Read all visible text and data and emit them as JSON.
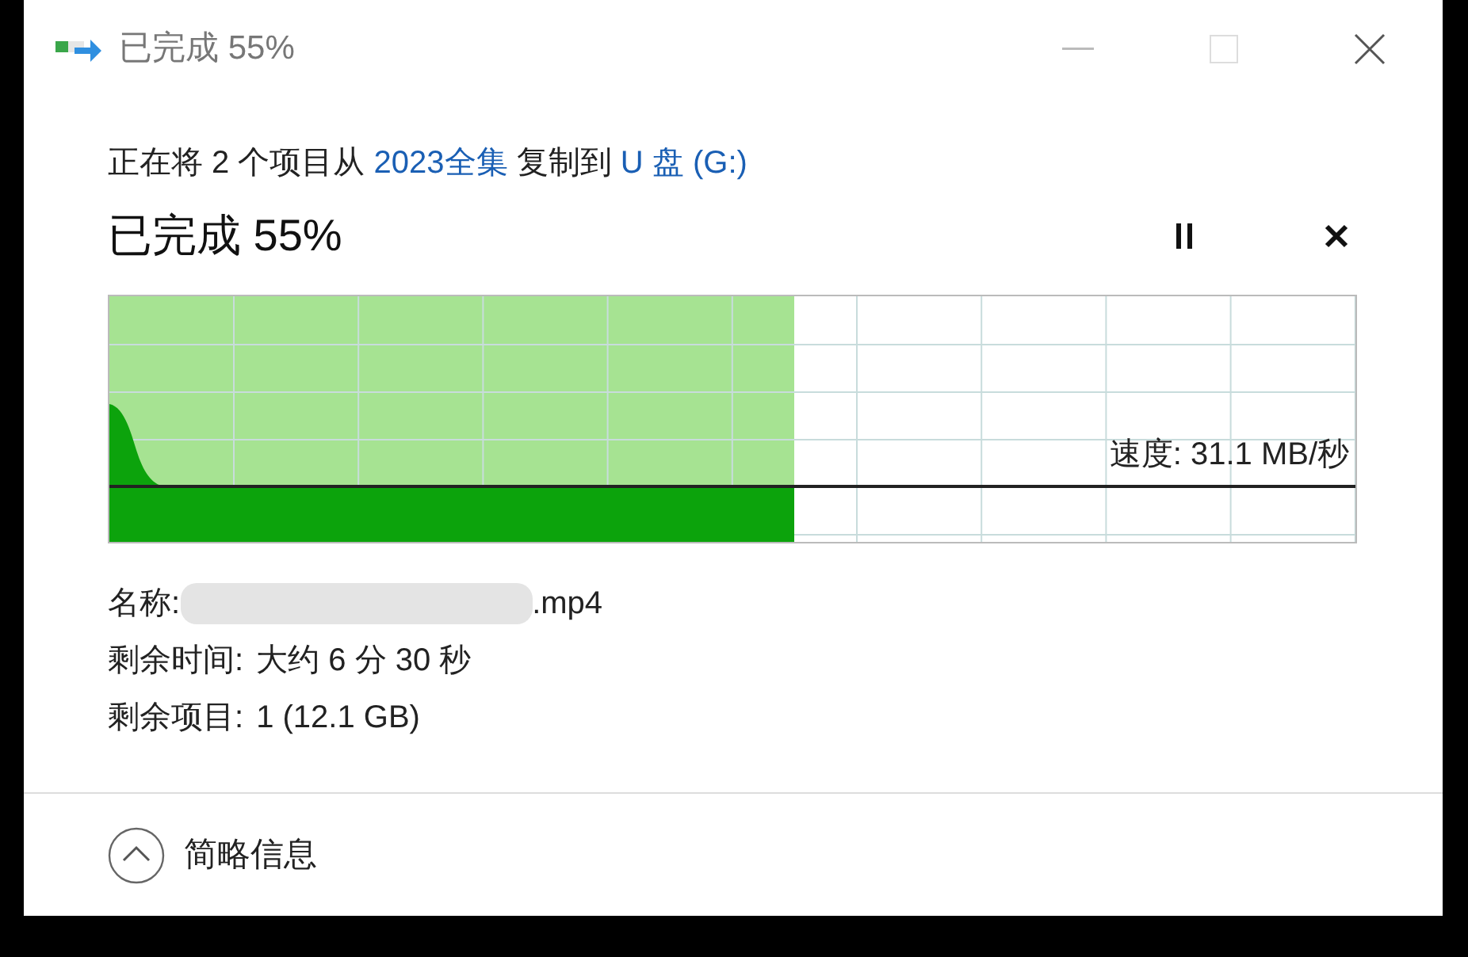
{
  "window": {
    "title": "已完成 55%"
  },
  "header": {
    "parts": [
      {
        "text": "正在将 2 个项目从 ",
        "kind": "plain"
      },
      {
        "text": "2023全集",
        "kind": "link"
      },
      {
        "text": " 复制到 ",
        "kind": "plain"
      },
      {
        "text": "U 盘 (G:)",
        "kind": "link"
      }
    ],
    "status": "已完成 55%"
  },
  "progress": {
    "level": 0.55,
    "speed": "速度: 31.1 MB/秒"
  },
  "details": [
    {
      "label": "名称:",
      "value": ".mp4",
      "redacted": true
    },
    {
      "label": "剩余时间:",
      "value": "大约 6 分 30 秒",
      "redacted": false
    },
    {
      "label": "剩余项目:",
      "value": "1 (12.1 GB)",
      "redacted": false
    }
  ],
  "footer": {
    "toggle": "简略信息",
    "expanded": true
  }
}
